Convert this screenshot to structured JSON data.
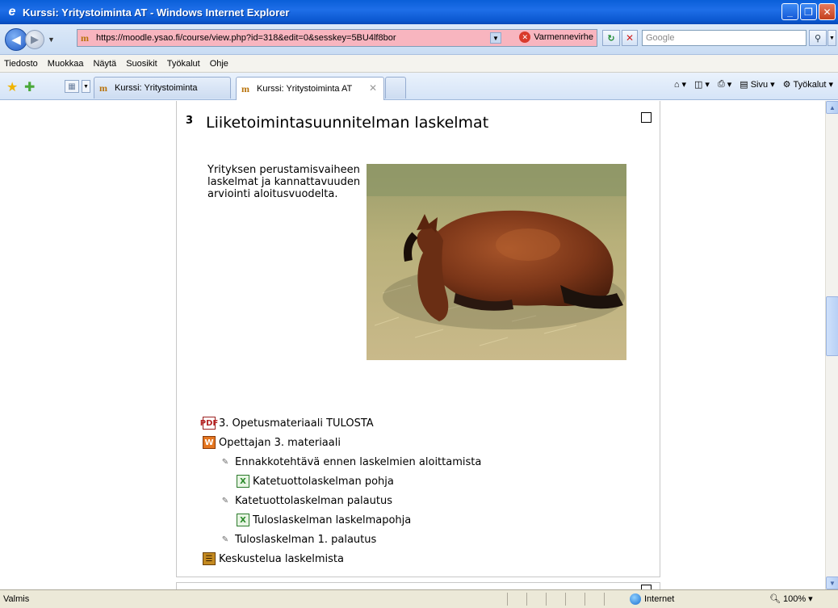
{
  "window": {
    "title": "Kurssi: Yritystoiminta AT - Windows Internet Explorer",
    "buttons": {
      "minimize": "_",
      "maximize": "❐",
      "close": "✕"
    }
  },
  "address": {
    "url": "https://moodle.ysao.fi/course/view.php?id=318&edit=0&sesskey=5BU4lf8bor",
    "cert_error": "Varmennevirhe",
    "search_placeholder": "Google"
  },
  "menu": [
    "Tiedosto",
    "Muokkaa",
    "Näytä",
    "Suosikit",
    "Työkalut",
    "Ohje"
  ],
  "tabs": [
    {
      "label": "Kurssi: Yritystoiminta"
    },
    {
      "label": "Kurssi: Yritystoiminta AT"
    }
  ],
  "command_bar": {
    "page": "Sivu",
    "tools": "Työkalut"
  },
  "section": {
    "number": "3",
    "title": "Liiketoimintasuunnitelman laskelmat",
    "summary": "Yrityksen perustamisvaiheen laskelmat ja kannattavuuden arviointi aloitusvuodelta.",
    "image_icon": "horse-photo"
  },
  "activities": [
    {
      "label": "3. Opetusmateriaali TULOSTA",
      "icon": "pdf-icon"
    },
    {
      "label": "Opettajan 3. materiaali",
      "icon": "document-icon"
    },
    {
      "label": "Ennakkotehtävä ennen laskelmien aloittamista",
      "icon": "assignment-icon"
    },
    {
      "label": "Katetuottolaskelman pohja",
      "icon": "spreadsheet-icon"
    },
    {
      "label": "Katetuottolaskelman palautus",
      "icon": "assignment-icon"
    },
    {
      "label": "Tuloslaskelman laskelmapohja",
      "icon": "spreadsheet-icon"
    },
    {
      "label": "Tuloslaskelman 1. palautus",
      "icon": "assignment-icon"
    },
    {
      "label": "Keskustelua laskelmista",
      "icon": "forum-icon"
    }
  ],
  "status": {
    "text": "Valmis",
    "zone": "Internet",
    "zoom": "100%"
  }
}
